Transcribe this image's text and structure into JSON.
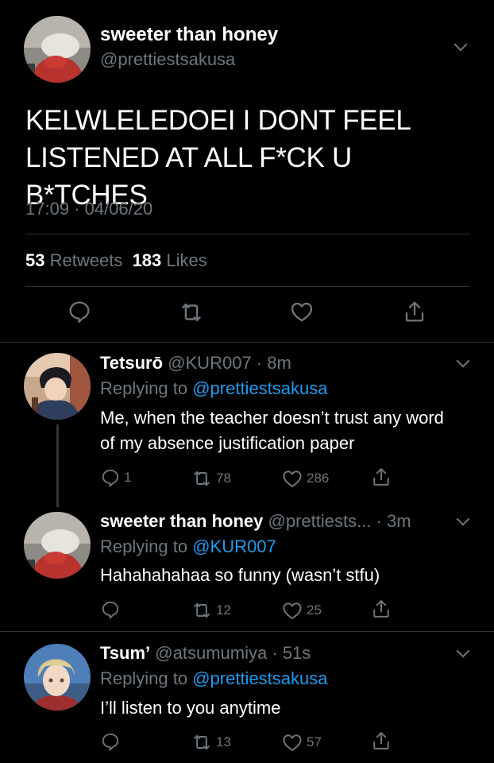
{
  "main_tweet": {
    "display_name": "sweeter than honey",
    "handle": "@prettiestsakusa",
    "text": "KELWLELEDOEI I DONT FEEL LISTENED AT ALL F*CK U B*TCHES",
    "timestamp": "17:09 · 04/06/20",
    "retweets": "53",
    "retweets_label": "Retweets",
    "likes": "183",
    "likes_label": "Likes"
  },
  "replies": [
    {
      "display_name": "Tetsurō",
      "handle": "@KUR007",
      "time": "· 8m",
      "replying_prefix": "Replying to",
      "replying_to": "@prettiestsakusa",
      "text": "Me, when the teacher doesn’t trust any word of my absence justification paper",
      "reply_count": "1",
      "retweet_count": "78",
      "like_count": "286"
    },
    {
      "display_name": "sweeter than honey",
      "handle": "@prettiests...",
      "time": "· 3m",
      "replying_prefix": "Replying to",
      "replying_to": "@KUR007",
      "text": "Hahahahahaa so funny (wasn’t stfu)",
      "reply_count": "",
      "retweet_count": "12",
      "like_count": "25"
    },
    {
      "display_name": "Tsum’",
      "handle": "@atsumumiya",
      "time": "· 51s",
      "replying_prefix": "Replying to",
      "replying_to": "@prettiestsakusa",
      "text": "I’ll listen to you anytime",
      "reply_count": "",
      "retweet_count": "13",
      "like_count": "57"
    }
  ],
  "colors": {
    "background": "#000000",
    "secondary_text": "#6e767d",
    "link": "#1d9bf0",
    "divider": "#2f3336"
  },
  "icons": [
    "reply-icon",
    "retweet-icon",
    "like-icon",
    "share-icon",
    "chevron-down-icon"
  ]
}
